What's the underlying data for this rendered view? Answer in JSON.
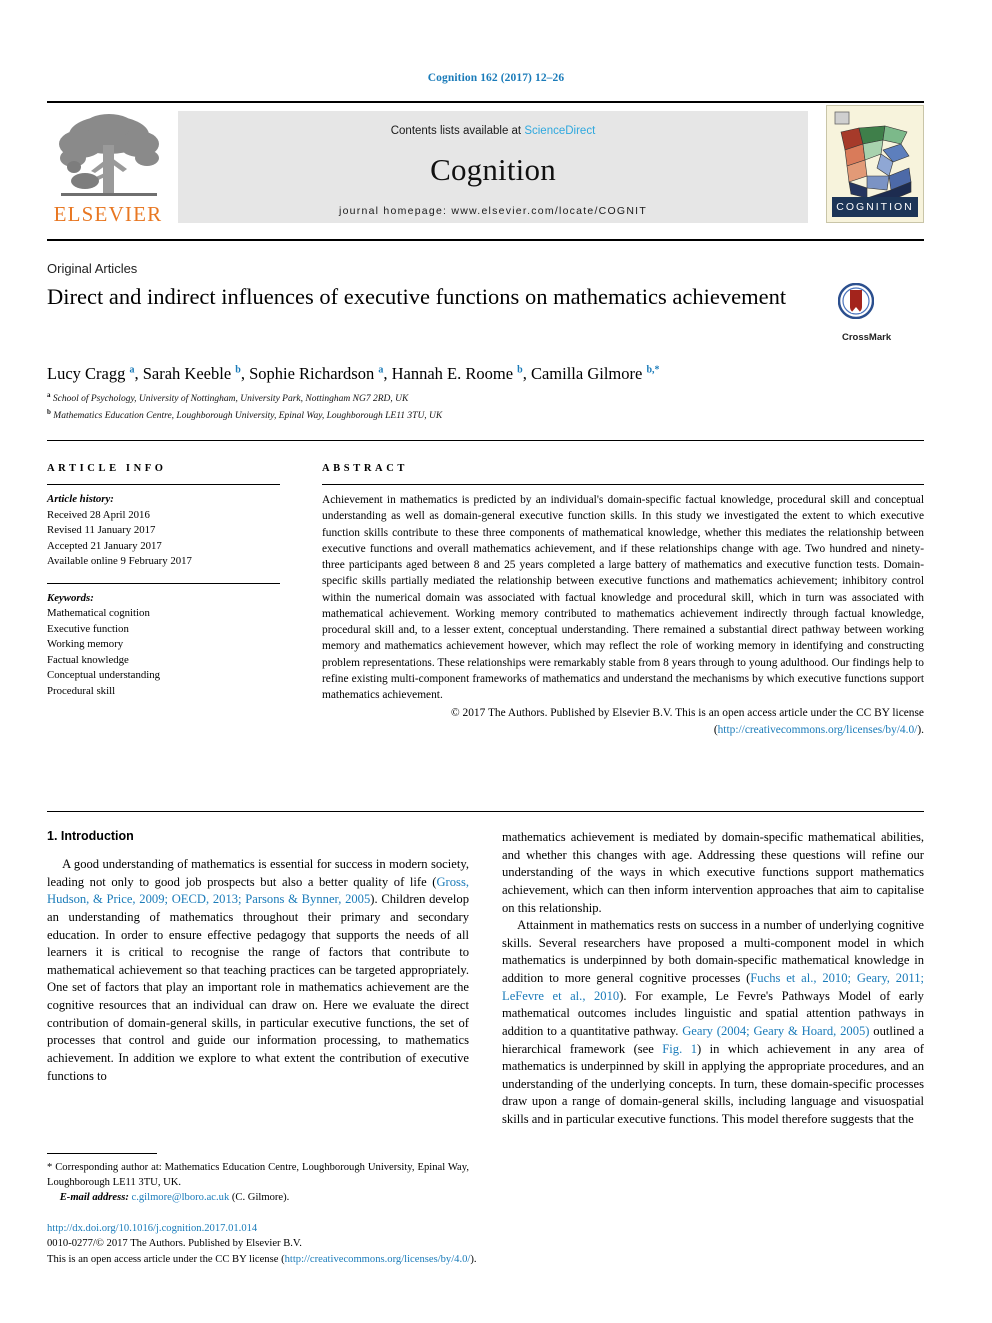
{
  "running_head": "Cognition 162 (2017) 12–26",
  "masthead": {
    "publisher_name": "ELSEVIER",
    "publisher_logo_name": "elsevier-tree-logo",
    "contents_prefix": "Contents lists available at ",
    "contents_link": "ScienceDirect",
    "journal_title": "Cognition",
    "homepage": "journal homepage: www.elsevier.com/locate/COGNIT",
    "cover_word": "COGNITION"
  },
  "article": {
    "type": "Original Articles",
    "title": "Direct and indirect influences of executive functions on mathematics achievement",
    "crossmark_label": "CrossMark",
    "authors_html": "Lucy Cragg <sup>a</sup>, Sarah Keeble <sup>b</sup>, Sophie Richardson <sup>a</sup>, Hannah E. Roome <sup>b</sup>, Camilla Gilmore <sup>b,</sup><sup>*</sup>",
    "affiliation_a": "School of Psychology, University of Nottingham, University Park, Nottingham NG7 2RD, UK",
    "affiliation_b": "Mathematics Education Centre, Loughborough University, Epinal Way, Loughborough LE11 3TU, UK"
  },
  "info": {
    "heading": "ARTICLE INFO",
    "history_label": "Article history:",
    "history": [
      "Received 28 April 2016",
      "Revised 11 January 2017",
      "Accepted 21 January 2017",
      "Available online 9 February 2017"
    ],
    "keywords_label": "Keywords:",
    "keywords": [
      "Mathematical cognition",
      "Executive function",
      "Working memory",
      "Factual knowledge",
      "Conceptual understanding",
      "Procedural skill"
    ]
  },
  "abstract": {
    "heading": "ABSTRACT",
    "text": "Achievement in mathematics is predicted by an individual's domain-specific factual knowledge, procedural skill and conceptual understanding as well as domain-general executive function skills. In this study we investigated the extent to which executive function skills contribute to these three components of mathematical knowledge, whether this mediates the relationship between executive functions and overall mathematics achievement, and if these relationships change with age. Two hundred and ninety-three participants aged between 8 and 25 years completed a large battery of mathematics and executive function tests. Domain-specific skills partially mediated the relationship between executive functions and mathematics achievement; inhibitory control within the numerical domain was associated with factual knowledge and procedural skill, which in turn was associated with mathematical achievement. Working memory contributed to mathematics achievement indirectly through factual knowledge, procedural skill and, to a lesser extent, conceptual understanding. There remained a substantial direct pathway between working memory and mathematics achievement however, which may reflect the role of working memory in identifying and constructing problem representations. These relationships were remarkably stable from 8 years through to young adulthood. Our findings help to refine existing multi-component frameworks of mathematics and understand the mechanisms by which executive functions support mathematics achievement.",
    "copyright_prefix": "© 2017 The Authors. Published by Elsevier B.V. This is an open access article under the CC BY license (",
    "copyright_link": "http://creativecommons.org/licenses/by/4.0/",
    "copyright_suffix": ")."
  },
  "body": {
    "section_heading": "1. Introduction",
    "left_paragraph_1": "A good understanding of mathematics is essential for success in modern society, leading not only to good job prospects but also a better quality of life (",
    "left_cite_1": "Gross, Hudson, & Price, 2009; OECD, 2013; Parsons & Bynner, 2005",
    "left_paragraph_1b": "). Children develop an understanding of mathematics throughout their primary and secondary education. In order to ensure effective pedagogy that supports the needs of all learners it is critical to recognise the range of factors that contribute to mathematical achievement so that teaching practices can be targeted appropriately. One set of factors that play an important role in mathematics achievement are the cognitive resources that an individual can draw on. Here we evaluate the direct contribution of domain-general skills, in particular executive functions, the set of processes that control and guide our information processing, to mathematics achievement. In addition we explore to what extent the contribution of executive functions to",
    "right_paragraph_1": "mathematics achievement is mediated by domain-specific mathematical abilities, and whether this changes with age. Addressing these questions will refine our understanding of the ways in which executive functions support mathematics achievement, which can then inform intervention approaches that aim to capitalise on this relationship.",
    "right_paragraph_2a": "Attainment in mathematics rests on success in a number of underlying cognitive skills. Several researchers have proposed a multi-component model in which mathematics is underpinned by both domain-specific mathematical knowledge in addition to more general cognitive processes (",
    "right_cite_1": "Fuchs et al., 2010; Geary, 2011; LeFevre et al., 2010",
    "right_paragraph_2b": "). For example, Le Fevre's Pathways Model of early mathematical outcomes includes linguistic and spatial attention pathways in addition to a quantitative pathway. ",
    "right_cite_2": "Geary (2004; Geary & Hoard, 2005)",
    "right_paragraph_2c": " outlined a hierarchical framework (see ",
    "right_cite_3": "Fig. 1",
    "right_paragraph_2d": ") in which achievement in any area of mathematics is underpinned by skill in applying the appropriate procedures, and an understanding of the underlying concepts. In turn, these domain-specific processes draw upon a range of domain-general skills, including language and visuospatial skills and in particular executive functions. This model therefore suggests that the"
  },
  "footnote": {
    "corresponding": "* Corresponding author at: Mathematics Education Centre, Loughborough University, Epinal Way, Loughborough LE11 3TU, UK.",
    "email_label": "E-mail address:",
    "email": "c.gilmore@lboro.ac.uk",
    "email_suffix": "(C. Gilmore)."
  },
  "page_footer": {
    "doi": "http://dx.doi.org/10.1016/j.cognition.2017.01.014",
    "issn_line": "0010-0277/© 2017 The Authors. Published by Elsevier B.V.",
    "license_prefix": "This is an open access article under the CC BY license (",
    "license_link": "http://creativecommons.org/licenses/by/4.0/",
    "license_suffix": ")."
  },
  "colors": {
    "link": "#1a7bb9",
    "sciencedirect": "#2fa8de",
    "elsevier_orange": "#e87722",
    "band_gray": "#e6e6e6"
  }
}
